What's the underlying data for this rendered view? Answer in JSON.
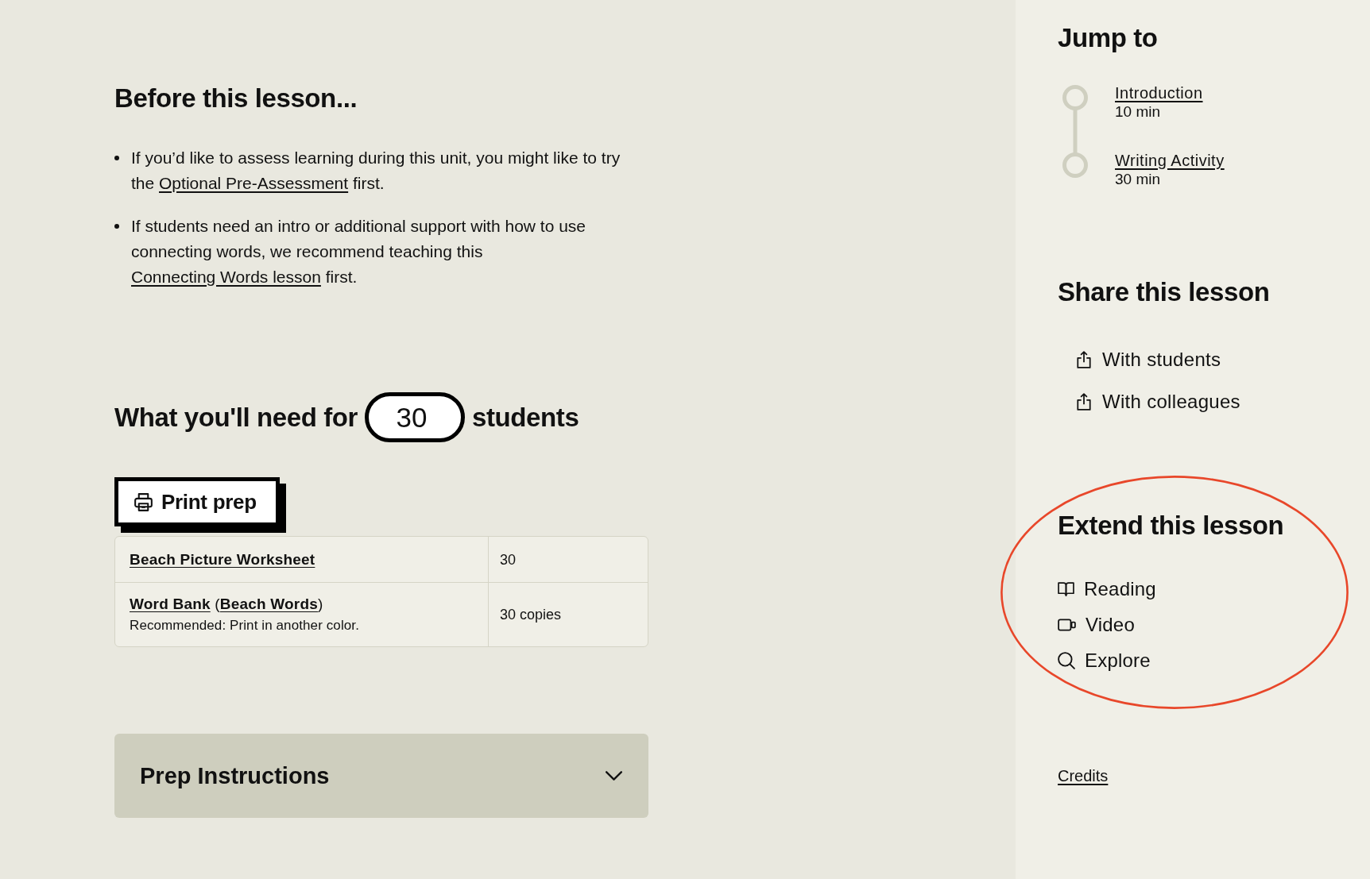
{
  "before_lesson": {
    "title": "Before this lesson...",
    "bullets": [
      [
        {
          "kind": "text",
          "text": "If you’d like to assess learning during this unit, you might like to try the "
        },
        {
          "kind": "link",
          "text": "Optional Pre-Assessment"
        },
        {
          "kind": "text",
          "text": " first."
        }
      ],
      [
        {
          "kind": "text",
          "text": "If students need an intro or additional support with how to use connecting words, we recommend teaching this "
        },
        {
          "kind": "link",
          "text": "Connecting Words lesson"
        },
        {
          "kind": "text",
          "text": " first."
        }
      ]
    ]
  },
  "materials": {
    "heading_before": "What you'll need for",
    "student_count": {
      "value": "30"
    },
    "heading_after": "students",
    "print_button": "Print prep",
    "rows": [
      {
        "name": [
          {
            "kind": "link",
            "text": "Beach Picture Worksheet"
          }
        ],
        "quantity": "30"
      },
      {
        "name": [
          {
            "kind": "link",
            "text": "Word Bank"
          },
          {
            "kind": "text",
            "text": " ("
          },
          {
            "kind": "link",
            "text": "Beach Words"
          },
          {
            "kind": "text",
            "text": ")"
          }
        ],
        "note": "Recommended: Print in another color.",
        "quantity": "30 copies"
      }
    ]
  },
  "prep_instructions": {
    "title": "Prep Instructions",
    "expanded": false
  },
  "jump_to": {
    "title": "Jump to",
    "items": [
      {
        "label": "Introduction",
        "duration": "10 min"
      },
      {
        "label": "Writing Activity",
        "duration": "30 min"
      }
    ]
  },
  "share": {
    "title": "Share this lesson",
    "items": [
      "With students",
      "With colleagues"
    ]
  },
  "extend": {
    "title": "Extend this lesson",
    "highlighted": true,
    "items": [
      {
        "kind": "reading",
        "label": "Reading"
      },
      {
        "kind": "video",
        "label": "Video"
      },
      {
        "kind": "explore",
        "label": "Explore"
      }
    ]
  },
  "credits": "Credits"
}
